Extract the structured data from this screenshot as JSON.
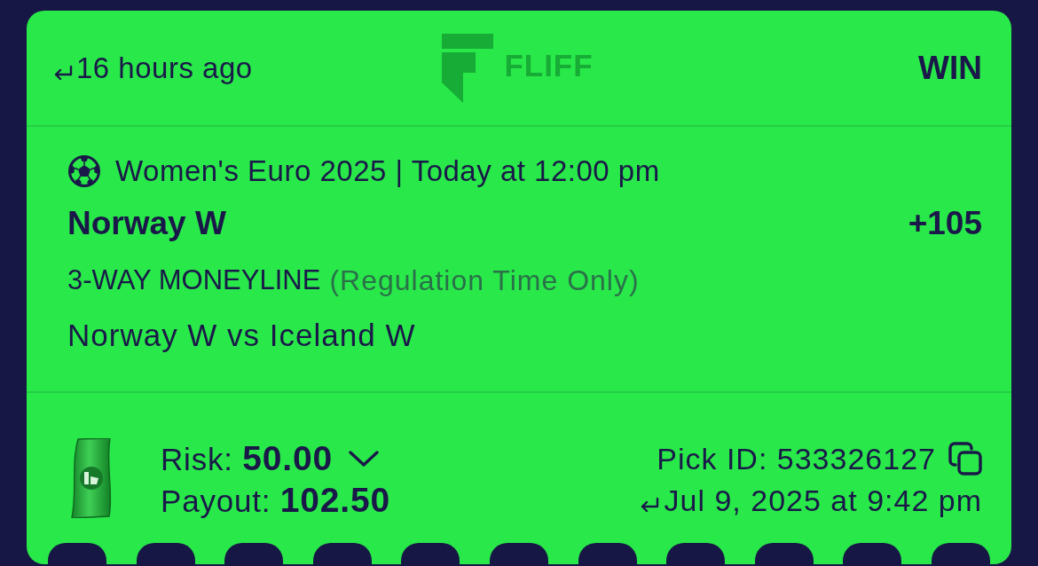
{
  "header": {
    "time_ago": "16 hours ago",
    "brand": "FLIFF",
    "result": "WIN"
  },
  "pick": {
    "event": "Women's Euro 2025 | Today at 12:00 pm",
    "selection": "Norway W",
    "odds": "+105",
    "market": "3-WAY MONEYLINE",
    "market_note": "(Regulation Time Only)",
    "matchup": "Norway W vs Iceland W"
  },
  "footer": {
    "risk": "Risk: **50.00**",
    "payout": "Payout: **102.50**",
    "pick_id": "Pick ID: 533326127",
    "placed_at": "Jul 9, 2025 at 9:42 pm"
  }
}
